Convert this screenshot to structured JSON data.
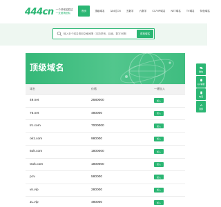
{
  "header": {
    "logo_number": "444cn",
    "logo_tagline_1": "一个好域名胜过",
    "logo_tagline_2": "一支营销团队",
    "nav": [
      {
        "label": "首页",
        "active": true
      },
      {
        "label": "顶级域名",
        "active": false
      },
      {
        "label": "3&4位CN",
        "active": false
      },
      {
        "label": "五数字",
        "active": false
      },
      {
        "label": "六数字",
        "active": false
      },
      {
        "label": "CC/VIP域名",
        "active": false
      },
      {
        "label": "NET域名",
        "active": false
      },
      {
        "label": "TV域名",
        "active": false
      },
      {
        "label": "特色域名",
        "active": false
      }
    ]
  },
  "search": {
    "placeholder": "输入多个域名请用空格间隔（支持拼音、后缀、数字分隔）",
    "button_label": "查找域名"
  },
  "banner": {
    "title": "顶级域名"
  },
  "side_tools": [
    {
      "label": "微信",
      "icon": "wechat-icon"
    },
    {
      "label": "QQ客服",
      "icon": "qq-icon"
    },
    {
      "label": "电话",
      "icon": "phone-icon"
    },
    {
      "label": "顶部",
      "icon": "arrow-up-icon"
    }
  ],
  "table": {
    "headers": {
      "name": "域名",
      "price": "价格",
      "action": "一键加入"
    },
    "add_label": "加入",
    "rows": [
      {
        "name": "49.net",
        "price": "2680000"
      },
      {
        "name": "75.net",
        "price": "480000"
      },
      {
        "name": "trc.com",
        "price": "7000000"
      },
      {
        "name": "ok1.com",
        "price": "980000"
      },
      {
        "name": "5ok.com",
        "price": "1800000"
      },
      {
        "name": "Gok.com",
        "price": "1800000"
      },
      {
        "name": "p.tv",
        "price": "580000"
      },
      {
        "name": "vn.vip",
        "price": "280000"
      },
      {
        "name": "JL.vip",
        "price": "480000"
      }
    ]
  },
  "colors": {
    "accent": "#2bb673",
    "band": "#eef7f1"
  }
}
